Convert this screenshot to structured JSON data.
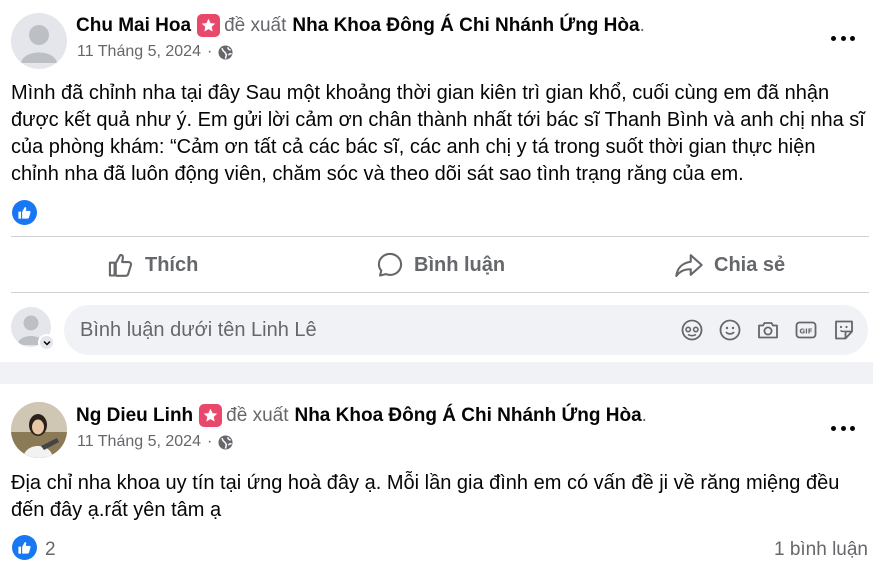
{
  "posts": [
    {
      "author": "Chu Mai Hoa",
      "verb": "đề xuất",
      "page": "Nha Khoa Đông Á Chi Nhánh Ứng Hòa",
      "period": ".",
      "date": "11 Tháng 5, 2024",
      "separator": "·",
      "text": "Mình đã chỉnh nha tại đây Sau một khoảng thời gian kiên trì gian khổ, cuối cùng em đã nhận được kết quả như ý. Em gửi lời cảm ơn chân thành nhất tới bác sĩ Thanh Bình và anh chị nha sĩ của phòng khám: “Cảm ơn tất cả các bác sĩ, các anh chị y tá trong suốt thời gian thực hiện chỉnh nha đã luôn động viên, chăm sóc và theo dõi sát sao tình trạng răng của em.",
      "actions": {
        "like": "Thích",
        "comment": "Bình luận",
        "share": "Chia sẻ"
      },
      "comment_placeholder": "Bình luận dưới tên Linh Lê"
    },
    {
      "author": "Ng Dieu Linh",
      "verb": "đề xuất",
      "page": "Nha Khoa Đông Á Chi Nhánh Ứng Hòa",
      "period": ".",
      "date": "11 Tháng 5, 2024",
      "separator": "·",
      "text": "Địa chỉ nha khoa uy tín tại ứng hoà đây ạ. Mỗi lần gia đình em có vấn đề ji về răng miệng đều đến đây ạ.rất yên tâm ạ",
      "like_count": "2",
      "comment_count": "1 bình luận"
    }
  ],
  "colors": {
    "accent": "#1877f2",
    "recommend_badge": "#e8496a",
    "secondary_text": "#65676b",
    "background": "#f0f2f5"
  },
  "icons": [
    "recommend-star-icon",
    "globe-icon",
    "more-options-icon",
    "like-badge-icon",
    "thumbs-up-icon",
    "comment-bubble-icon",
    "share-arrow-icon",
    "avatar-icon",
    "chevron-down-icon",
    "avatar-sticker-icon",
    "emoji-icon",
    "camera-icon",
    "gif-icon",
    "sticker-icon"
  ]
}
